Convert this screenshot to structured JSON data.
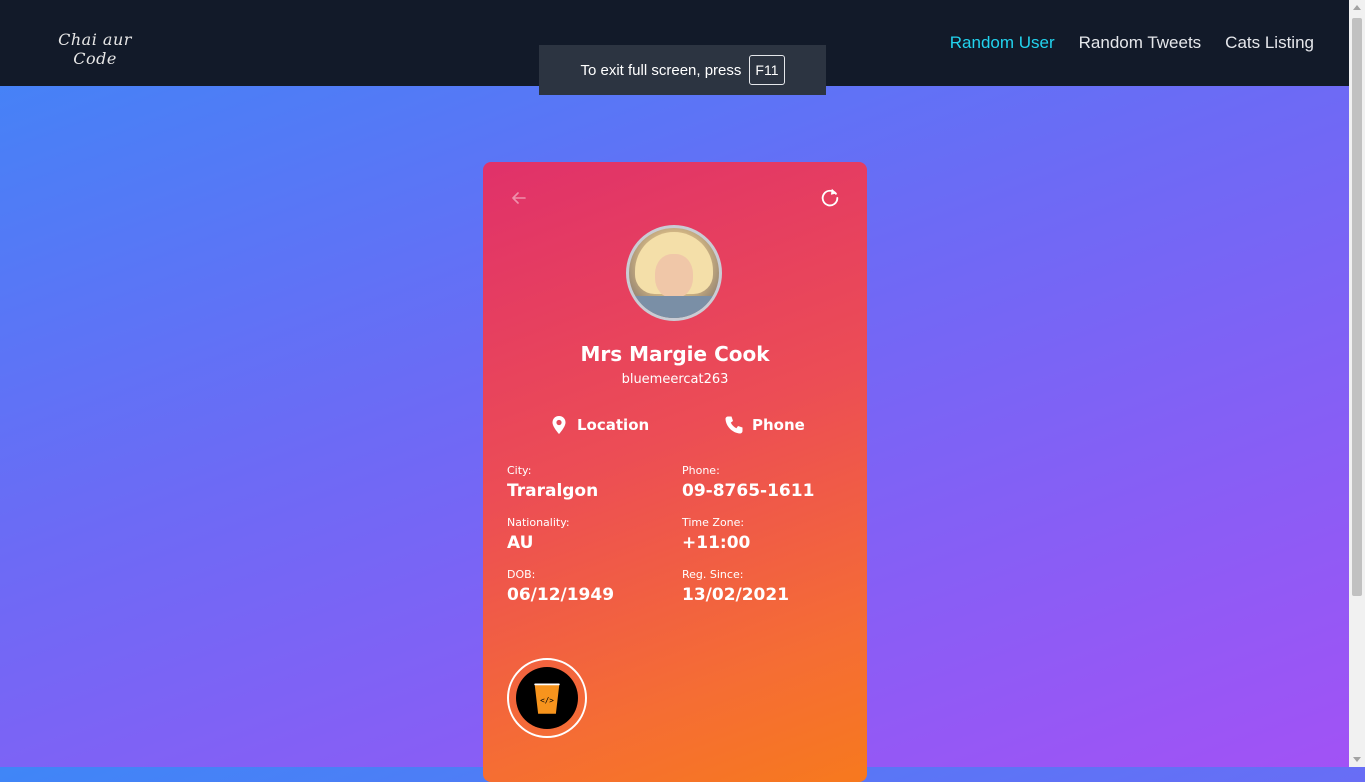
{
  "nav": {
    "logo": "Chai aur Code",
    "links": [
      {
        "label": "Random User",
        "active": true
      },
      {
        "label": "Random Tweets",
        "active": false
      },
      {
        "label": "Cats Listing",
        "active": false
      }
    ]
  },
  "fullscreen_toast": {
    "text": "To exit full screen, press",
    "key": "F11"
  },
  "card": {
    "name": "Mrs Margie Cook",
    "username": "bluemeercat263",
    "tabs": {
      "location": "Location",
      "phone": "Phone"
    },
    "fields": {
      "city": {
        "label": "City:",
        "value": "Traralgon"
      },
      "phone": {
        "label": "Phone:",
        "value": "09-8765-1611"
      },
      "nationality": {
        "label": "Nationality:",
        "value": "AU"
      },
      "timezone": {
        "label": "Time Zone:",
        "value": "+11:00"
      },
      "dob": {
        "label": "DOB:",
        "value": "06/12/1949"
      },
      "reg_since": {
        "label": "Reg. Since:",
        "value": "13/02/2021"
      }
    },
    "badge_text": "</>"
  },
  "colors": {
    "nav_bg": "#121a29",
    "nav_active": "#22d3ee",
    "card_gradient_start": "#e0316a",
    "card_gradient_end": "#f7791e"
  },
  "icons": [
    "back-arrow-icon",
    "refresh-icon",
    "map-pin-icon",
    "phone-icon",
    "chai-cup-icon"
  ]
}
